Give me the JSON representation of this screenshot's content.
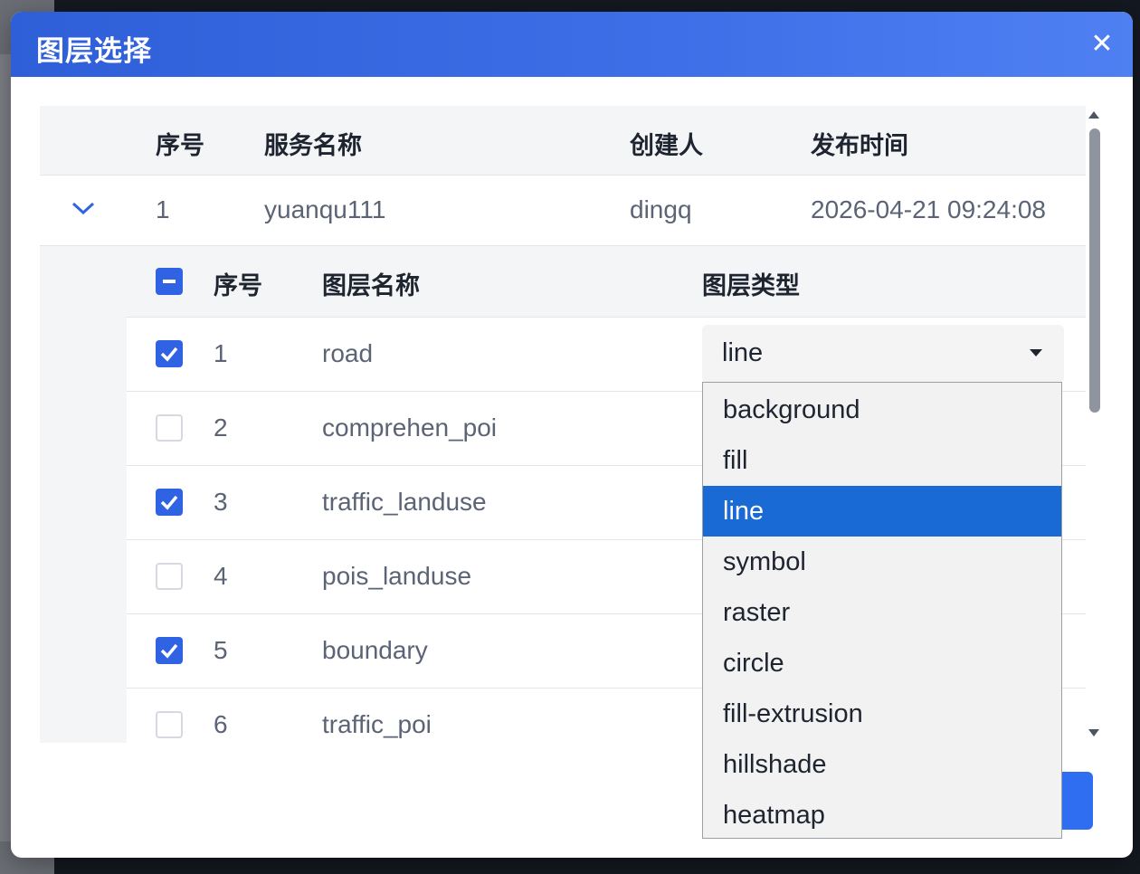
{
  "dialog": {
    "title": "图层选择"
  },
  "outer_table": {
    "headers": {
      "index": "序号",
      "service_name": "服务名称",
      "creator": "创建人",
      "publish_time": "发布时间"
    },
    "rows": [
      {
        "index": "1",
        "service_name": "yuanqu111",
        "creator": "dingq",
        "publish_time": "2026-04-21 09:24:08",
        "expanded": true
      }
    ]
  },
  "inner_table": {
    "headers": {
      "index": "序号",
      "layer_name": "图层名称",
      "layer_type": "图层类型"
    },
    "select_all_state": "indeterminate",
    "rows": [
      {
        "index": "1",
        "layer_name": "road",
        "checked": true,
        "layer_type": "line"
      },
      {
        "index": "2",
        "layer_name": "comprehen_poi",
        "checked": false
      },
      {
        "index": "3",
        "layer_name": "traffic_landuse",
        "checked": true
      },
      {
        "index": "4",
        "layer_name": "pois_landuse",
        "checked": false
      },
      {
        "index": "5",
        "layer_name": "boundary",
        "checked": true
      },
      {
        "index": "6",
        "layer_name": "traffic_poi",
        "checked": false
      }
    ]
  },
  "layer_type_dropdown": {
    "selected": "line",
    "options": [
      "background",
      "fill",
      "line",
      "symbol",
      "raster",
      "circle",
      "fill-extrusion",
      "hillshade",
      "heatmap"
    ]
  },
  "colors": {
    "header_gradient_start": "#2e5fd8",
    "header_gradient_end": "#4f80f2",
    "checkbox_checked": "#2f63e4",
    "dropdown_selected": "#1a6ad6"
  }
}
